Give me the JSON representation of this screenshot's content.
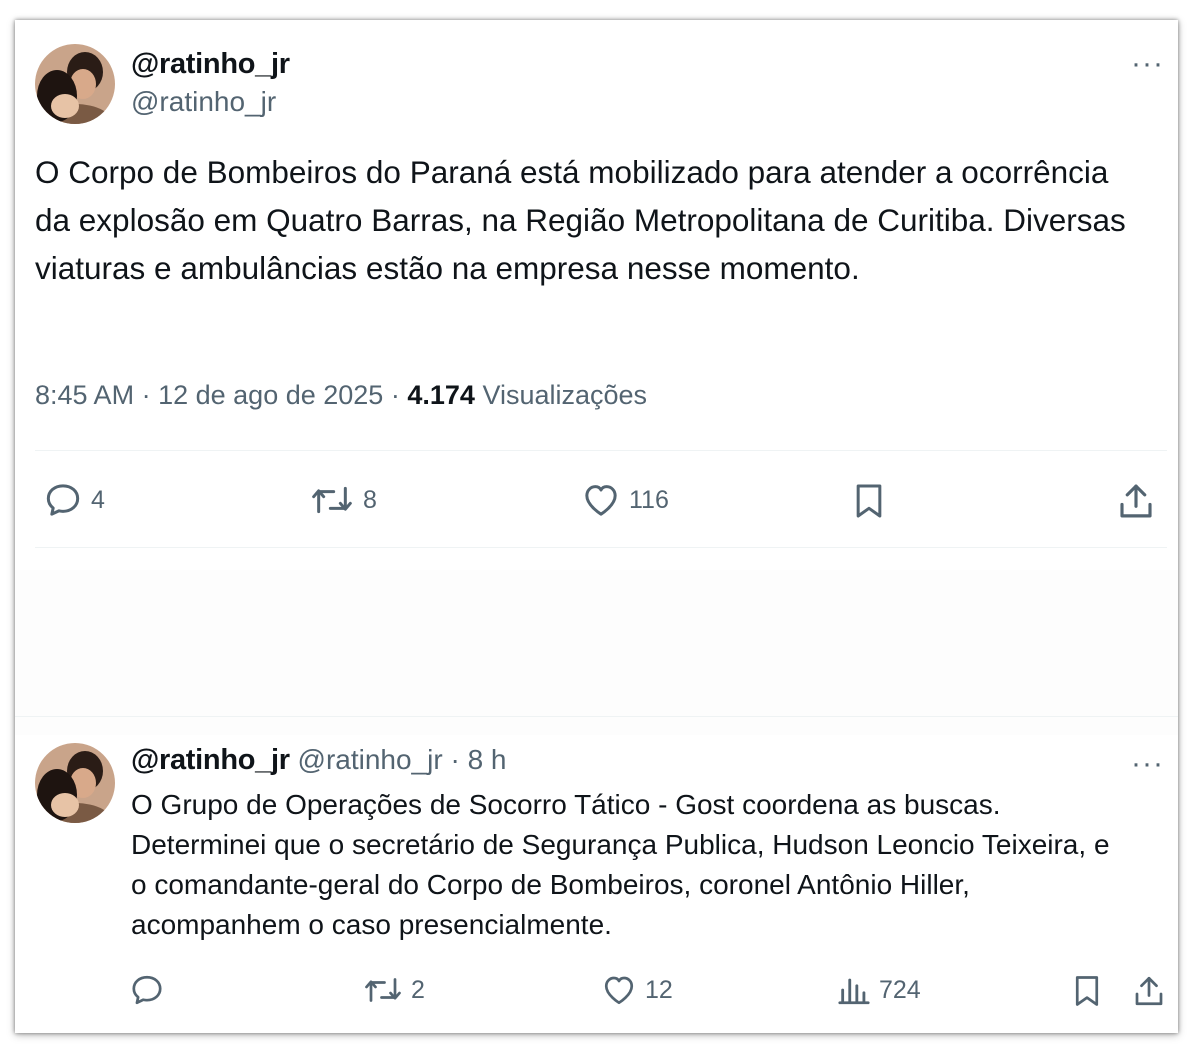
{
  "tweet": {
    "display_name": "@ratinho_jr",
    "handle": "@ratinho_jr",
    "more_label": "···",
    "text": "O Corpo de Bombeiros do Paraná está mobilizado para atender a ocorrência da explosão em Quatro Barras, na Região Metropolitana de Curitiba. Diversas viaturas e ambulâncias estão na empresa nesse momento.",
    "time": "8:45 AM",
    "separator": "·",
    "date": "12 de ago de 2025",
    "views_count": "4.174",
    "views_label": "Visualizações",
    "actions": {
      "replies": "4",
      "reposts": "8",
      "likes": "116"
    }
  },
  "reply": {
    "display_name": "@ratinho_jr",
    "handle": "@ratinho_jr",
    "separator": "·",
    "age": "8 h",
    "more_label": "···",
    "text": "O Grupo de Operações de Socorro Tático - Gost coordena as buscas. Determinei que o secretário de Segurança Publica, Hudson Leoncio Teixeira, e o comandante-geral do Corpo de Bombeiros, coronel Antônio Hiller, acompanhem o caso presencialmente.",
    "actions": {
      "replies": "",
      "reposts": "2",
      "likes": "12",
      "views": "724"
    }
  },
  "icons": {
    "reply": "reply-icon",
    "repost": "repost-icon",
    "like": "heart-icon",
    "bookmark": "bookmark-icon",
    "share": "share-icon",
    "views": "analytics-icon",
    "more": "more-icon"
  },
  "colors": {
    "text": "#0f1419",
    "secondary": "#536471",
    "divider": "#eff3f4"
  }
}
